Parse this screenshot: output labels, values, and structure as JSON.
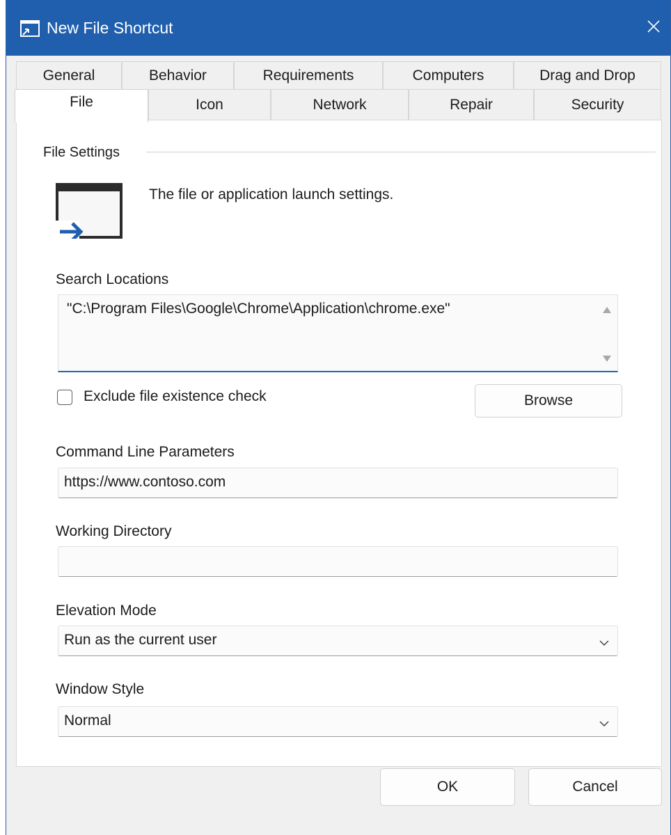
{
  "window": {
    "title": "New File Shortcut"
  },
  "tabs": {
    "row1": [
      "General",
      "Behavior",
      "Requirements",
      "Computers",
      "Drag and Drop"
    ],
    "row2": [
      "File",
      "Icon",
      "Network",
      "Repair",
      "Security"
    ],
    "active": "File"
  },
  "section": {
    "title": "File Settings",
    "description": "The file or application launch settings."
  },
  "search_locations": {
    "label": "Search Locations",
    "value": "\"C:\\Program Files\\Google\\Chrome\\Application\\chrome.exe\""
  },
  "exclude_check": {
    "label": "Exclude file existence check",
    "checked": false
  },
  "browse_button": "Browse",
  "command_line": {
    "label": "Command Line Parameters",
    "value": "https://www.contoso.com"
  },
  "working_directory": {
    "label": "Working Directory",
    "value": ""
  },
  "elevation_mode": {
    "label": "Elevation Mode",
    "selected": "Run as the current user"
  },
  "window_style": {
    "label": "Window Style",
    "selected": "Normal"
  },
  "footer": {
    "ok": "OK",
    "cancel": "Cancel"
  },
  "colors": {
    "titlebar": "#1f5fae",
    "accent": "#1e63b8",
    "dialog_bg": "#f0f0f0"
  },
  "icons": [
    "shortcut-window-icon",
    "close-icon",
    "file-launch-icon",
    "scroll-up-icon",
    "scroll-down-icon",
    "chevron-down-icon"
  ]
}
